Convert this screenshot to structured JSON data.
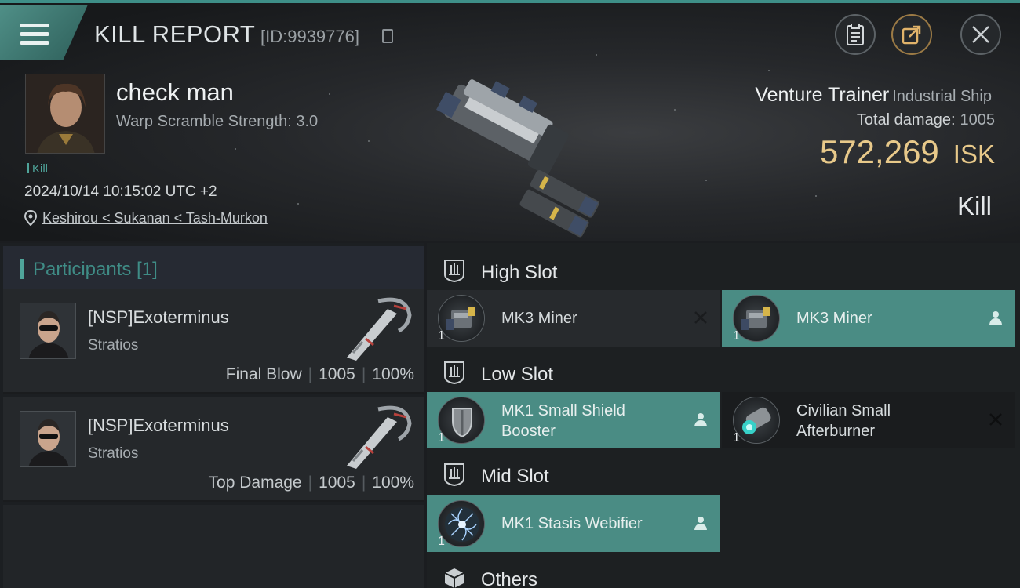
{
  "header": {
    "title": "KILL REPORT",
    "report_id": "[ID:9939776]"
  },
  "victim": {
    "name": "check man",
    "warp_scramble": "Warp Scramble Strength: 3.0",
    "tag": "Kill",
    "datetime": "2024/10/14 10:15:02 UTC +2",
    "location": "Keshirou < Sukanan < Tash-Murkon"
  },
  "ship": {
    "name": "Venture Trainer",
    "class": "Industrial Ship",
    "total_damage_label": "Total damage:",
    "total_damage_value": "1005",
    "isk_value": "572,269",
    "isk_unit": "ISK",
    "result": "Kill"
  },
  "participants": {
    "title": "Participants [1]",
    "items": [
      {
        "name": "[NSP]Exoterminus",
        "ship": "Stratios",
        "role": "Final Blow",
        "damage": "1005",
        "percent": "100%"
      },
      {
        "name": "[NSP]Exoterminus",
        "ship": "Stratios",
        "role": "Top Damage",
        "damage": "1005",
        "percent": "100%"
      }
    ]
  },
  "slots": {
    "high": {
      "label": "High Slot",
      "modules": [
        {
          "name": "MK3 Miner",
          "qty": "1",
          "status": "destroyed"
        },
        {
          "name": "MK3 Miner",
          "qty": "1",
          "status": "dropped"
        }
      ]
    },
    "low": {
      "label": "Low Slot",
      "modules": [
        {
          "name": "MK1 Small Shield Booster",
          "name_line1": "MK1 Small Shield",
          "name_line2": "Booster",
          "qty": "1",
          "status": "dropped"
        },
        {
          "name": "Civilian Small Afterburner",
          "name_line1": "Civilian Small",
          "name_line2": "Afterburner",
          "qty": "1",
          "status": "destroyed"
        }
      ]
    },
    "mid": {
      "label": "Mid Slot",
      "modules": [
        {
          "name": "MK1 Stasis Webifier",
          "qty": "1",
          "status": "dropped"
        }
      ]
    },
    "others": {
      "label": "Others"
    }
  },
  "colors": {
    "accent_teal": "#4a8c84",
    "isk_gold": "#e8c98a"
  },
  "icons": [
    "menu-icon",
    "clipboard-icon",
    "share-icon",
    "close-icon",
    "location-pin-icon",
    "copy-icon",
    "slot-icon",
    "cube-icon",
    "person-icon",
    "x-mark-icon"
  ]
}
